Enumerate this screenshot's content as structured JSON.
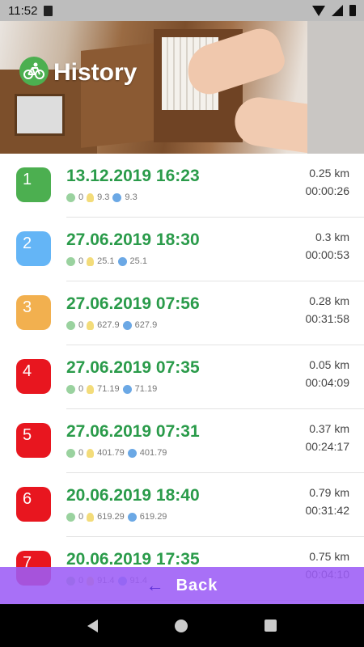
{
  "status": {
    "time": "11:52"
  },
  "header": {
    "title": "History",
    "logo_icon": "bicycle-icon"
  },
  "colors": {
    "green_title": "#2a9b4a",
    "back_bar": "#9c5cf6"
  },
  "history": [
    {
      "index": "1",
      "color": "#4caf50",
      "date": "13.12.2019 16:23",
      "cloud": "0",
      "bulb": "9.3",
      "globe": "9.3",
      "distance": "0.25 km",
      "duration": "00:00:26"
    },
    {
      "index": "2",
      "color": "#64b5f6",
      "date": "27.06.2019 18:30",
      "cloud": "0",
      "bulb": "25.1",
      "globe": "25.1",
      "distance": "0.3 km",
      "duration": "00:00:53"
    },
    {
      "index": "3",
      "color": "#f2b04f",
      "date": "27.06.2019 07:56",
      "cloud": "0",
      "bulb": "627.9",
      "globe": "627.9",
      "distance": "0.28 km",
      "duration": "00:31:58"
    },
    {
      "index": "4",
      "color": "#e8161f",
      "date": "27.06.2019 07:35",
      "cloud": "0",
      "bulb": "71.19",
      "globe": "71.19",
      "distance": "0.05 km",
      "duration": "00:04:09"
    },
    {
      "index": "5",
      "color": "#e8161f",
      "date": "27.06.2019 07:31",
      "cloud": "0",
      "bulb": "401.79",
      "globe": "401.79",
      "distance": "0.37 km",
      "duration": "00:24:17"
    },
    {
      "index": "6",
      "color": "#e8161f",
      "date": "20.06.2019 18:40",
      "cloud": "0",
      "bulb": "619.29",
      "globe": "619.29",
      "distance": "0.79 km",
      "duration": "00:31:42"
    },
    {
      "index": "7",
      "color": "#e8161f",
      "date": "20.06.2019 17:35",
      "cloud": "0",
      "bulb": "91.4",
      "globe": "91.4",
      "distance": "0.75 km",
      "duration": "00:04:10"
    }
  ],
  "back_button": {
    "label": "Back"
  }
}
